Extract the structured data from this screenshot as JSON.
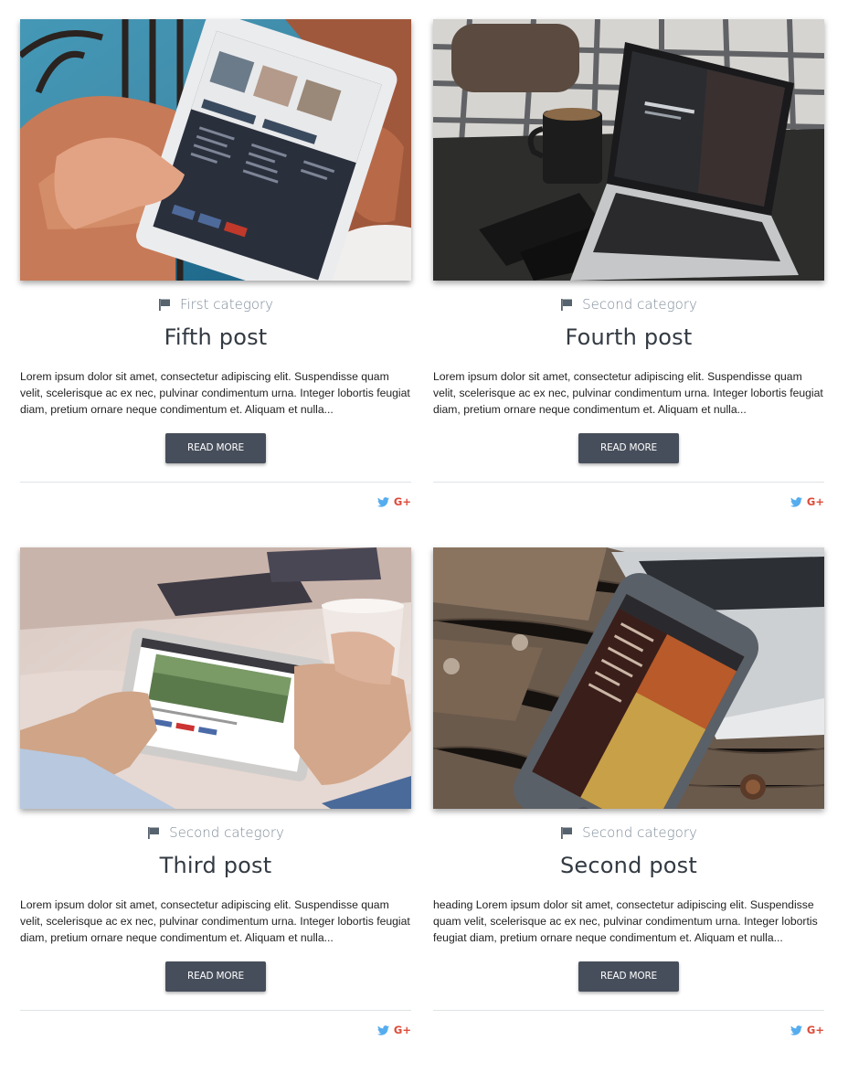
{
  "posts": [
    {
      "image": "tablet-on-balcony-photo",
      "category": "First category",
      "title": "Fifth post",
      "excerpt": "Lorem ipsum dolor sit amet, consectetur adipiscing elit. Suspendisse quam velit, scelerisque ac ex nec, pulvinar condimentum urna. Integer lobortis feugiat diam, pretium ornare neque condimentum et. Aliquam et nulla...",
      "button": "READ MORE",
      "share": [
        "twitter-icon",
        "google-plus-icon"
      ],
      "gplus_label": "G+"
    },
    {
      "image": "laptop-and-coffee-photo",
      "category": "Second category",
      "title": "Fourth post",
      "excerpt": "Lorem ipsum dolor sit amet, consectetur adipiscing elit. Suspendisse quam velit, scelerisque ac ex nec, pulvinar condimentum urna. Integer lobortis feugiat diam, pretium ornare neque condimentum et. Aliquam et nulla...",
      "button": "READ MORE",
      "share": [
        "twitter-icon",
        "google-plus-icon"
      ],
      "gplus_label": "G+"
    },
    {
      "image": "tablet-in-hands-photo",
      "category": "Second category",
      "title": "Third post",
      "excerpt": "Lorem ipsum dolor sit amet, consectetur adipiscing elit. Suspendisse quam velit, scelerisque ac ex nec, pulvinar condimentum urna. Integer lobortis feugiat diam, pretium ornare neque condimentum et. Aliquam et nulla...",
      "button": "READ MORE",
      "share": [
        "twitter-icon",
        "google-plus-icon"
      ],
      "gplus_label": "G+"
    },
    {
      "image": "phone-on-wood-photo",
      "category": "Second category",
      "title": "Second post",
      "excerpt": "heading Lorem ipsum dolor sit amet, consectetur adipiscing elit. Suspendisse quam velit, scelerisque ac ex nec, pulvinar condimentum urna. Integer lobortis feugiat diam, pretium ornare neque condimentum et. Aliquam et nulla...",
      "button": "READ MORE",
      "share": [
        "twitter-icon",
        "google-plus-icon"
      ],
      "gplus_label": "G+"
    }
  ],
  "colors": {
    "button_bg": "#474e5b",
    "category_text": "#7f8c99",
    "title_text": "#333a42",
    "twitter": "#55acee",
    "google_plus": "#dd4b39",
    "divider": "#dfe3e6"
  }
}
